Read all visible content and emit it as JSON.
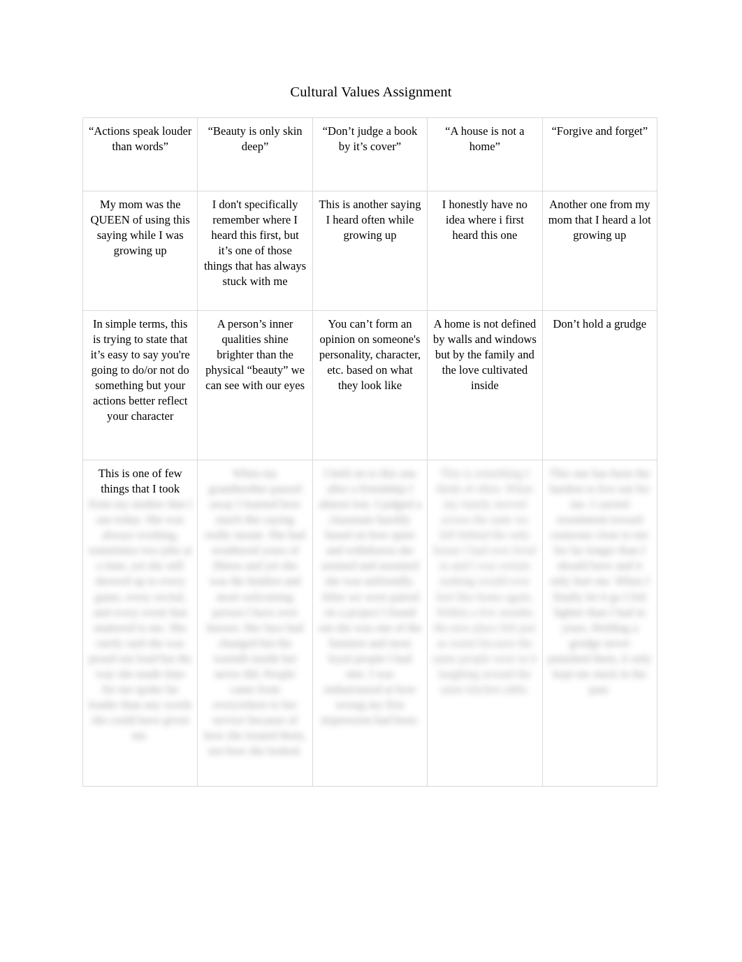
{
  "document": {
    "title": "Cultural Values Assignment"
  },
  "table": {
    "columns": [
      "“Actions speak louder than words”",
      "“Beauty is only skin deep”",
      "“Don’t judge a book by it’s cover”",
      "“A house is not a home”",
      "“Forgive and forget”"
    ],
    "rows": {
      "origin": [
        "My mom was the QUEEN of using this saying while I was growing up",
        "I don't specifically remember where I heard this first, but it’s one of those things that has always stuck with me",
        "This is another saying I heard often while growing up",
        "I honestly have no idea where i first heard this one",
        "Another one from my mom that I heard a lot growing up"
      ],
      "meaning": [
        "In simple terms, this is trying to state that it’s easy to say you're going to do/or not do something but your actions better reflect your character",
        "A person’s inner qualities shine brighter than the physical “beauty” we can see with our eyes",
        "You can’t form an opinion on someone's personality, character, etc. based on what they look like",
        "A home is not defined by walls and windows but by the family and the love cultivated inside",
        "Don’t hold a grudge"
      ],
      "personal_visible": [
        "This is one of few things that I took",
        "",
        "",
        "",
        ""
      ],
      "personal_blurred": [
        "from my mother that I use today. She was always working, sometimes two jobs at a time, yet she still showed up to every game, every recital, and every event that mattered to me. She rarely said she was proud out loud but the way she made time for me spoke far louder than any words she could have given me.",
        "When my grandmother passed away I learned how much this saying really meant. She had weathered years of illness and yet she was the kindest and most welcoming person I have ever known. Her face had changed but the warmth inside her never did. People came from everywhere to her service because of how she treated them, not how she looked.",
        "I held on to this one after a friendship I almost lost. I judged a classmate harshly based on how quiet and withdrawn she seemed and assumed she was unfriendly. After we were paired on a project I found out she was one of the funniest and most loyal people I had met. I was embarrassed at how wrong my first impression had been.",
        "This is something I think of often. When my family moved across the state we left behind the only house I had ever lived in and I was certain nothing would ever feel like home again. Within a few months the new place felt just as warm because the same people were in it laughing around the same kitchen table.",
        "This one has been the hardest to live out for me. I carried resentment toward someone close to me for far longer than I should have and it only hurt me. When I finally let it go I felt lighter than I had in years. Holding a grudge never punished them, it only kept me stuck in the past."
      ]
    }
  }
}
